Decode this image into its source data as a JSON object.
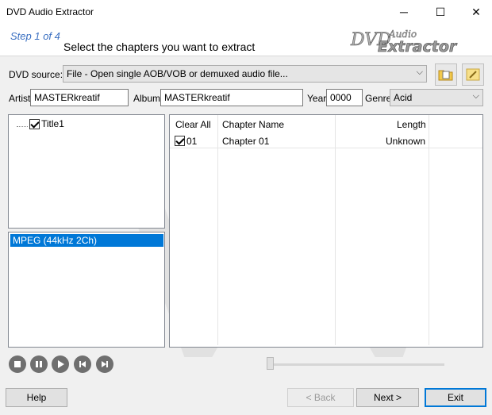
{
  "window": {
    "title": "DVD Audio Extractor",
    "minimize": "─",
    "maximize": "☐",
    "close": "✕"
  },
  "header": {
    "step": "Step 1 of 4",
    "instruction": "Select the chapters you want to extract",
    "logo_line1": "DVD",
    "logo_line2": "Audio",
    "logo_line3": "Extractor"
  },
  "source": {
    "label": "DVD source:",
    "value": "File - Open single AOB/VOB or demuxed audio file..."
  },
  "meta": {
    "artist_label": "Artist",
    "artist_value": "MASTERkreatif",
    "album_label": "Album",
    "album_value": "MASTERkreatif",
    "year_label": "Year",
    "year_value": "0000",
    "genre_label": "Genre",
    "genre_value": "Acid"
  },
  "tree": {
    "title1": "Title1"
  },
  "streams": {
    "selected": "MPEG (44kHz 2Ch)"
  },
  "chapters": {
    "headers": {
      "clear_all": "Clear All",
      "name": "Chapter Name",
      "length": "Length"
    },
    "rows": [
      {
        "num": "01",
        "name": "Chapter 01",
        "length": "Unknown"
      }
    ]
  },
  "player": {
    "icons": [
      "stop-icon",
      "pause-icon",
      "play-icon",
      "previous-icon",
      "next-icon"
    ]
  },
  "buttons": {
    "help": "Help",
    "back": "< Back",
    "next": "Next >",
    "exit": "Exit"
  },
  "colors": {
    "accent": "#0078d7",
    "step_text": "#3a6fc1"
  }
}
